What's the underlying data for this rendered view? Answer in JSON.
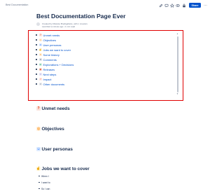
{
  "header": {
    "breadcrumb": "Best Documentation",
    "share_label": "Share",
    "more_label": "…",
    "icons": [
      "edit-icon",
      "comment-icon",
      "star-icon",
      "watch-icon",
      "restrict-icon"
    ]
  },
  "page": {
    "title": "Best Documentation Page Ever",
    "byline": "Created by Melanie Bredtgallerie, with n creators",
    "updated": "Last Red a minute ago • 1 min read"
  },
  "toc": {
    "items": [
      {
        "label": "Unmet needs",
        "icon": "question-mark-icon",
        "symbol": "?",
        "color": "#de350b"
      },
      {
        "label": "Objectives",
        "icon": "target-icon",
        "symbol": "◎",
        "color": "#ff991f"
      },
      {
        "label": "User personas",
        "icon": "people-icon",
        "symbol": "☺",
        "color": "#0065ff"
      },
      {
        "label": "Jobs we want to cover",
        "icon": "pointing-hand-icon",
        "symbol": "☝",
        "color": "#ffc400"
      },
      {
        "label": "Some history",
        "icon": "book-icon",
        "symbol": "≡",
        "color": "#ff8b00"
      },
      {
        "label": "Comments",
        "icon": "eyes-icon",
        "symbol": "••",
        "color": "#42526e"
      },
      {
        "label": "Explorations + Decisions",
        "icon": "map-icon",
        "symbol": "▤",
        "color": "#36b37e"
      },
      {
        "label": "Releases",
        "icon": "calendar-icon",
        "symbol": "▦",
        "color": "#de350b"
      },
      {
        "label": "Next steps",
        "icon": "footprints-icon",
        "symbol": "•",
        "color": "#6554c0"
      },
      {
        "label": "Impact",
        "icon": "chart-icon",
        "symbol": "↗",
        "color": "#ff5630"
      },
      {
        "label": "Other documents",
        "icon": "link-icon",
        "symbol": "∞",
        "color": "#6b778c"
      }
    ]
  },
  "sections": [
    {
      "title": "Unmet needs",
      "icon": "question-mark-icon",
      "symbol": "?",
      "color": "#de350b"
    },
    {
      "title": "Objectives",
      "icon": "target-icon",
      "symbol": "◎",
      "color": "#ff991f"
    },
    {
      "title": "User personas",
      "icon": "people-icon",
      "symbol": "☺",
      "color": "#0065ff"
    },
    {
      "title": "Jobs we want to cover",
      "icon": "pointing-hand-icon",
      "symbol": "☝",
      "color": "#ffc400"
    }
  ],
  "jobs_list": [
    "When I",
    "I want to",
    "So I can"
  ]
}
